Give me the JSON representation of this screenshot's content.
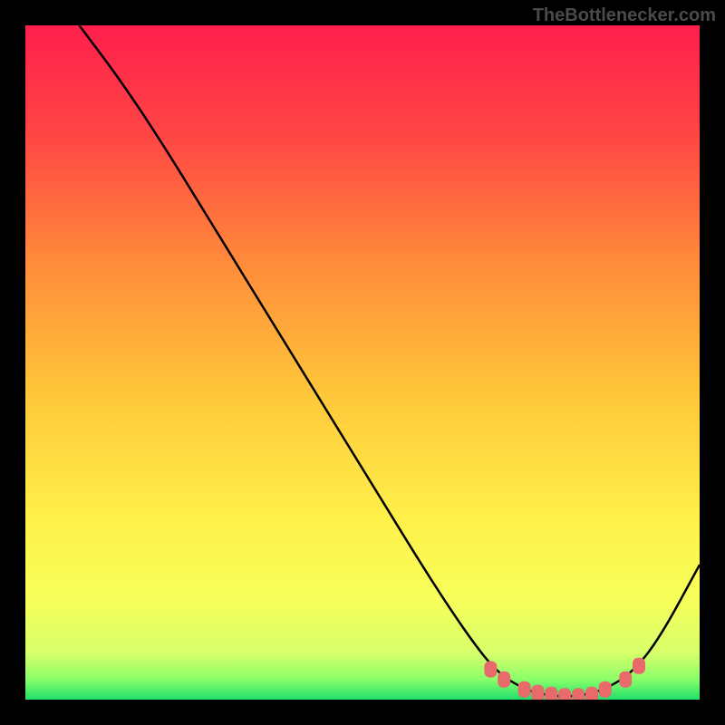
{
  "watermark": "TheBottlenecker.com",
  "chart_data": {
    "type": "line",
    "title": "",
    "xlabel": "",
    "ylabel": "",
    "xlim": [
      0,
      100
    ],
    "ylim": [
      0,
      100
    ],
    "gradient_colors": {
      "top": "#ff1f4c",
      "mid1": "#ff7a3a",
      "mid2": "#ffd23a",
      "mid3": "#fff84a",
      "bottom": "#1fe06a"
    },
    "curve_points": [
      {
        "x": 8,
        "y": 100
      },
      {
        "x": 14,
        "y": 92
      },
      {
        "x": 20,
        "y": 83
      },
      {
        "x": 28,
        "y": 70
      },
      {
        "x": 36,
        "y": 57
      },
      {
        "x": 44,
        "y": 44
      },
      {
        "x": 52,
        "y": 31
      },
      {
        "x": 60,
        "y": 18
      },
      {
        "x": 66,
        "y": 9
      },
      {
        "x": 70,
        "y": 4
      },
      {
        "x": 74,
        "y": 1.5
      },
      {
        "x": 78,
        "y": 0.5
      },
      {
        "x": 82,
        "y": 0.5
      },
      {
        "x": 86,
        "y": 1.5
      },
      {
        "x": 90,
        "y": 4
      },
      {
        "x": 94,
        "y": 9
      },
      {
        "x": 100,
        "y": 20
      }
    ],
    "marker_points": [
      {
        "x": 69,
        "y": 4.5
      },
      {
        "x": 71,
        "y": 3
      },
      {
        "x": 74,
        "y": 1.5
      },
      {
        "x": 76,
        "y": 1
      },
      {
        "x": 78,
        "y": 0.7
      },
      {
        "x": 80,
        "y": 0.5
      },
      {
        "x": 82,
        "y": 0.5
      },
      {
        "x": 84,
        "y": 0.7
      },
      {
        "x": 86,
        "y": 1.5
      },
      {
        "x": 89,
        "y": 3
      },
      {
        "x": 91,
        "y": 5
      }
    ],
    "marker_color": "#e86a6a",
    "curve_color": "#000000"
  }
}
